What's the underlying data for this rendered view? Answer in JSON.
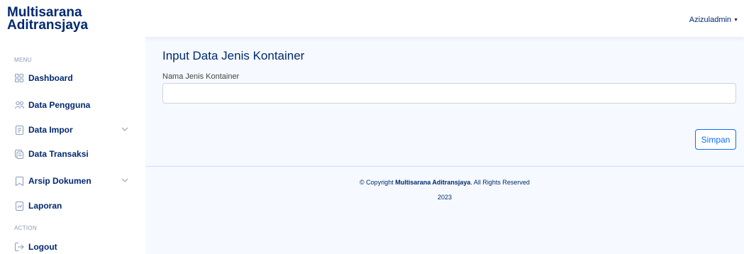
{
  "brand": {
    "line1": "Multisarana",
    "line2": "Aditransjaya"
  },
  "user": {
    "name": "Azizuladmin"
  },
  "sidebar": {
    "menu_heading": "MENU",
    "action_heading": "ACTION",
    "items": [
      {
        "label": "Dashboard",
        "icon": "grid-icon"
      },
      {
        "label": "Data Pengguna",
        "icon": "people-icon"
      },
      {
        "label": "Data Impor",
        "icon": "file-text-icon",
        "expandable": true
      },
      {
        "label": "Data Transaksi",
        "icon": "receipt-icon"
      },
      {
        "label": "Arsip Dokumen",
        "icon": "archive-icon",
        "expandable": true
      },
      {
        "label": "Laporan",
        "icon": "report-icon"
      }
    ],
    "logout": {
      "label": "Logout",
      "icon": "logout-icon"
    }
  },
  "main": {
    "title": "Input Data Jenis Kontainer",
    "field_label": "Nama Jenis Kontainer",
    "field_value": "",
    "save_label": "Simpan"
  },
  "footer": {
    "prefix": "© Copyright ",
    "company": "Multisarana Aditransjaya",
    "suffix": ". All Rights Reserved",
    "year": "2023"
  },
  "colors": {
    "primary": "#012970",
    "accent": "#0d6efd",
    "background": "#f6f9ff",
    "muted": "#899bbd"
  }
}
